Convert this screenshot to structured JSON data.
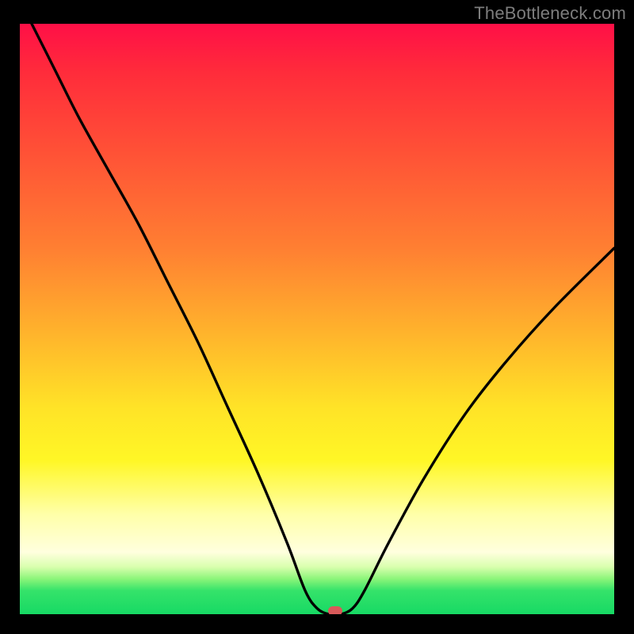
{
  "watermark": "TheBottleneck.com",
  "colors": {
    "curve_stroke": "#000000",
    "marker_fill": "#d85a5a",
    "frame_bg": "#000000"
  },
  "chart_data": {
    "type": "line",
    "title": "",
    "xlabel": "",
    "ylabel": "",
    "xlim": [
      0,
      100
    ],
    "ylim": [
      0,
      100
    ],
    "grid": false,
    "legend": false,
    "series": [
      {
        "name": "bottleneck-curve",
        "x": [
          2,
          6,
          10,
          15,
          20,
          25,
          30,
          35,
          40,
          45,
          48,
          50,
          52,
          54,
          56,
          58,
          62,
          68,
          75,
          82,
          90,
          100
        ],
        "y": [
          100,
          92,
          84,
          75,
          66,
          56,
          46,
          35,
          24,
          12,
          4,
          1,
          0,
          0,
          1,
          4,
          12,
          23,
          34,
          43,
          52,
          62
        ]
      }
    ],
    "marker": {
      "x": 53,
      "y": 0.5
    },
    "background_gradient": [
      {
        "stop": 0,
        "color": "#ff0f47"
      },
      {
        "stop": 0.22,
        "color": "#ff5236"
      },
      {
        "stop": 0.52,
        "color": "#ffb22c"
      },
      {
        "stop": 0.74,
        "color": "#fff726"
      },
      {
        "stop": 0.9,
        "color": "#ffffde"
      },
      {
        "stop": 0.96,
        "color": "#35e36a"
      },
      {
        "stop": 1.0,
        "color": "#17d964"
      }
    ]
  }
}
